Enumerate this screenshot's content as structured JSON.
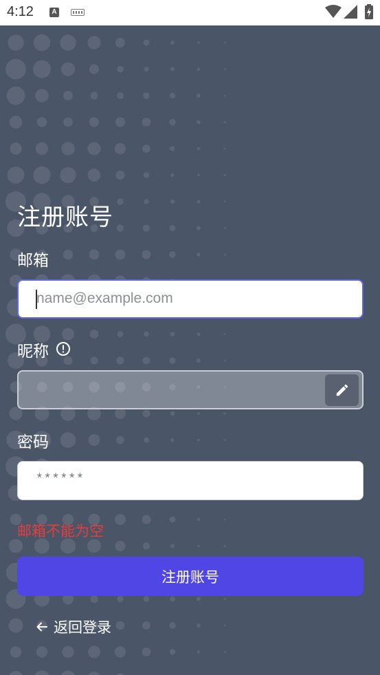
{
  "status_bar": {
    "time": "4:12",
    "notification_icon": "A",
    "icons": [
      "a-icon",
      "keyboard-icon",
      "wifi-icon",
      "signal-icon",
      "battery-icon"
    ]
  },
  "form": {
    "title": "注册账号",
    "email": {
      "label": "邮箱",
      "placeholder": "name@example.com",
      "value": ""
    },
    "nickname": {
      "label": "昵称",
      "value": "",
      "info_icon": "info-circle-icon",
      "edit_icon": "pencil-icon"
    },
    "password": {
      "label": "密码",
      "placeholder": "******",
      "value": ""
    },
    "error_message": "邮箱不能为空",
    "submit_label": "注册账号",
    "back_label": "返回登录"
  },
  "colors": {
    "background": "#4a5568",
    "accent": "#4f46e5",
    "focus_border": "#6366f1",
    "error": "#e53e3e"
  }
}
